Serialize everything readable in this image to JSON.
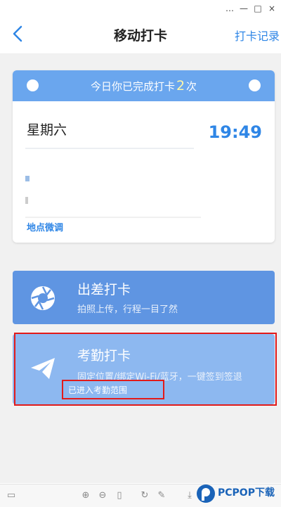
{
  "window_controls": {
    "menu_icon": "…",
    "minimize": "—",
    "maximize": "□",
    "close": "×"
  },
  "nav": {
    "back_icon": "chevron-left-icon",
    "title": "移动打卡",
    "right_link": "打卡记录"
  },
  "banner": {
    "prefix": "今日你已完成打卡",
    "count": "2",
    "suffix": "次"
  },
  "ticket": {
    "weekday": "星期六",
    "time": "19:49",
    "location_adjust": "地点微调"
  },
  "cards": [
    {
      "title": "出差打卡",
      "subtitle": "拍照上传，行程一目了然",
      "icon": "camera-shutter-icon"
    },
    {
      "title": "考勤打卡",
      "subtitle": "固定位置/绑定Wi-Fi/蓝牙，一键签到签退",
      "icon": "paper-plane-icon",
      "status": "已进入考勤范围"
    }
  ],
  "watermark": {
    "text": "PCPOP下载"
  },
  "colors": {
    "accent": "#2f86e6",
    "banner": "#6aa6ee",
    "card1": "#5f95e2",
    "card2": "#8db8f0",
    "highlight": "#e21a1a"
  }
}
